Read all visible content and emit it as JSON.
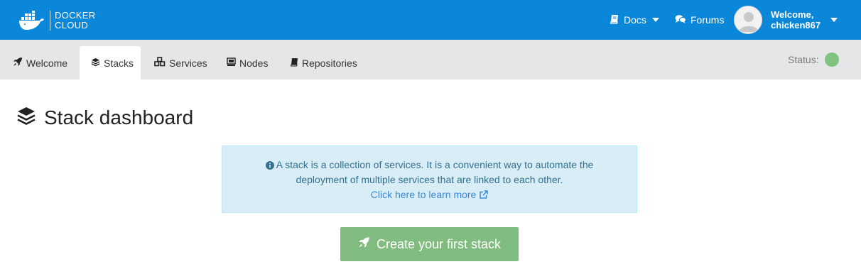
{
  "app": {
    "logo_line1": "DOCKER",
    "logo_line2": "CLOUD",
    "brand_color": "#0b87da"
  },
  "header": {
    "docs_label": "Docs",
    "forums_label": "Forums",
    "user": {
      "welcome_line1": "Welcome,",
      "username": "chicken867"
    }
  },
  "tabs": [
    {
      "label": "Welcome",
      "icon": "rocket-icon",
      "active": false
    },
    {
      "label": "Stacks",
      "icon": "layers-icon",
      "active": true
    },
    {
      "label": "Services",
      "icon": "cubes-icon",
      "active": false
    },
    {
      "label": "Nodes",
      "icon": "server-icon",
      "active": false
    },
    {
      "label": "Repositories",
      "icon": "book-icon",
      "active": false
    }
  ],
  "status": {
    "label": "Status:",
    "color": "#80c27f"
  },
  "page": {
    "title": "Stack dashboard",
    "title_icon": "layers-icon"
  },
  "info": {
    "line1": "A stack is a collection of services. It is a convenient way to automate the",
    "line2": "deployment of multiple services that are linked to each other.",
    "link_text": "Click here to learn more",
    "link_icon": "external-link-icon",
    "background": "#d9edf7"
  },
  "cta": {
    "label": "Create your first stack",
    "icon": "rocket-icon",
    "color": "#80bb80"
  }
}
